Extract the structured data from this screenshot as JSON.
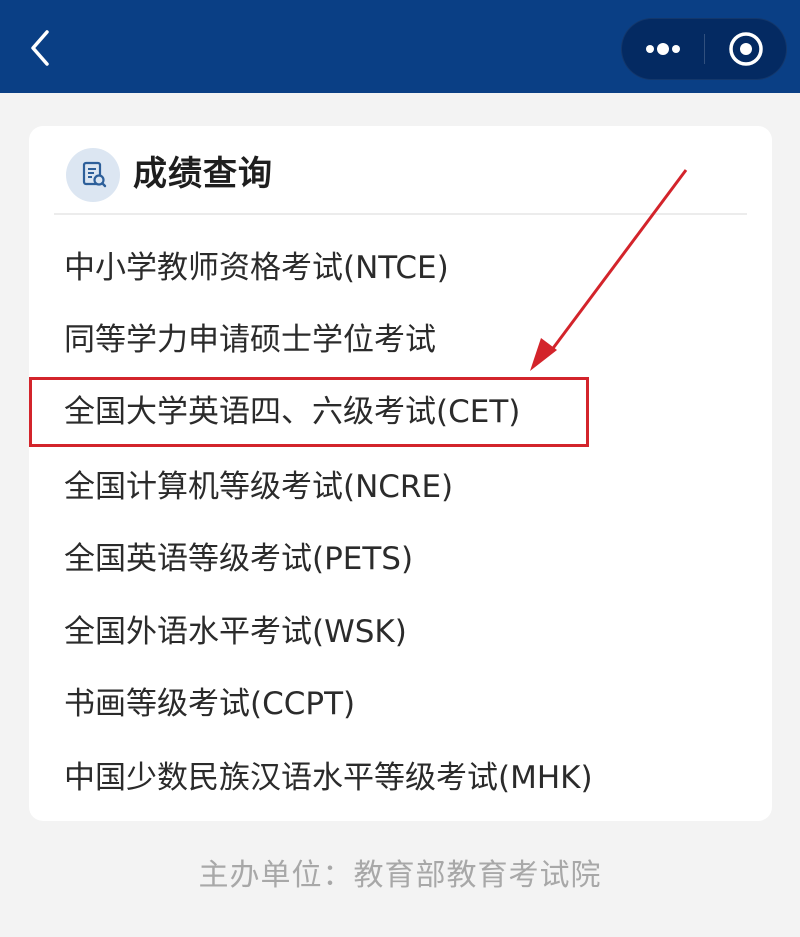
{
  "nav": {
    "back_icon": "chevron-left-icon",
    "more_icon": "more-dots-icon",
    "close_icon": "target-circle-icon"
  },
  "card": {
    "title": "成绩查询",
    "title_icon": "search-document-icon",
    "items": [
      {
        "label": "中小学教师资格考试(NTCE)"
      },
      {
        "label": "同等学力申请硕士学位考试"
      },
      {
        "label": "全国大学英语四、六级考试(CET)"
      },
      {
        "label": "全国计算机等级考试(NCRE)"
      },
      {
        "label": "全国英语等级考试(PETS)"
      },
      {
        "label": "全国外语水平考试(WSK)"
      },
      {
        "label": "书画等级考试(CCPT)"
      },
      {
        "label": "中国少数民族汉语水平等级考试(MHK)"
      }
    ]
  },
  "annotation": {
    "highlighted_item": "全国大学英语四、六级考试(CET)",
    "color": "#d3242b"
  },
  "footer": {
    "text": "主办单位：教育部教育考试院"
  },
  "colors": {
    "topbar": "#0a3f85",
    "background": "#f3f3f3",
    "card": "#ffffff"
  }
}
